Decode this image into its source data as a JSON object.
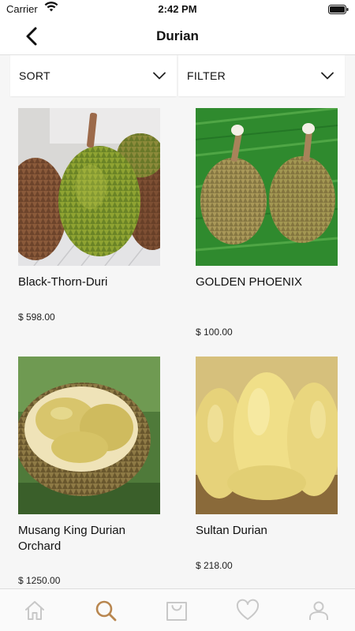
{
  "status": {
    "carrier": "Carrier",
    "time": "2:42 PM"
  },
  "header": {
    "title": "Durian"
  },
  "controls": {
    "sort_label": "SORT",
    "filter_label": "FILTER"
  },
  "products": [
    {
      "name": "Black-Thorn-Duri",
      "price": "$ 598.00"
    },
    {
      "name": "GOLDEN PHOENIX",
      "price": "$ 100.00"
    },
    {
      "name": "Musang King Durian Orchard",
      "price": "$ 1250.00"
    },
    {
      "name": "Sultan Durian",
      "price": "$ 218.00"
    }
  ],
  "tabs": [
    {
      "icon": "home-icon",
      "active": false
    },
    {
      "icon": "search-icon",
      "active": true
    },
    {
      "icon": "shopping-bag-icon",
      "active": false
    },
    {
      "icon": "heart-icon",
      "active": false
    },
    {
      "icon": "profile-icon",
      "active": false
    }
  ],
  "colors": {
    "accent": "#b8864f",
    "inactive_icon": "#c8c8c8"
  }
}
